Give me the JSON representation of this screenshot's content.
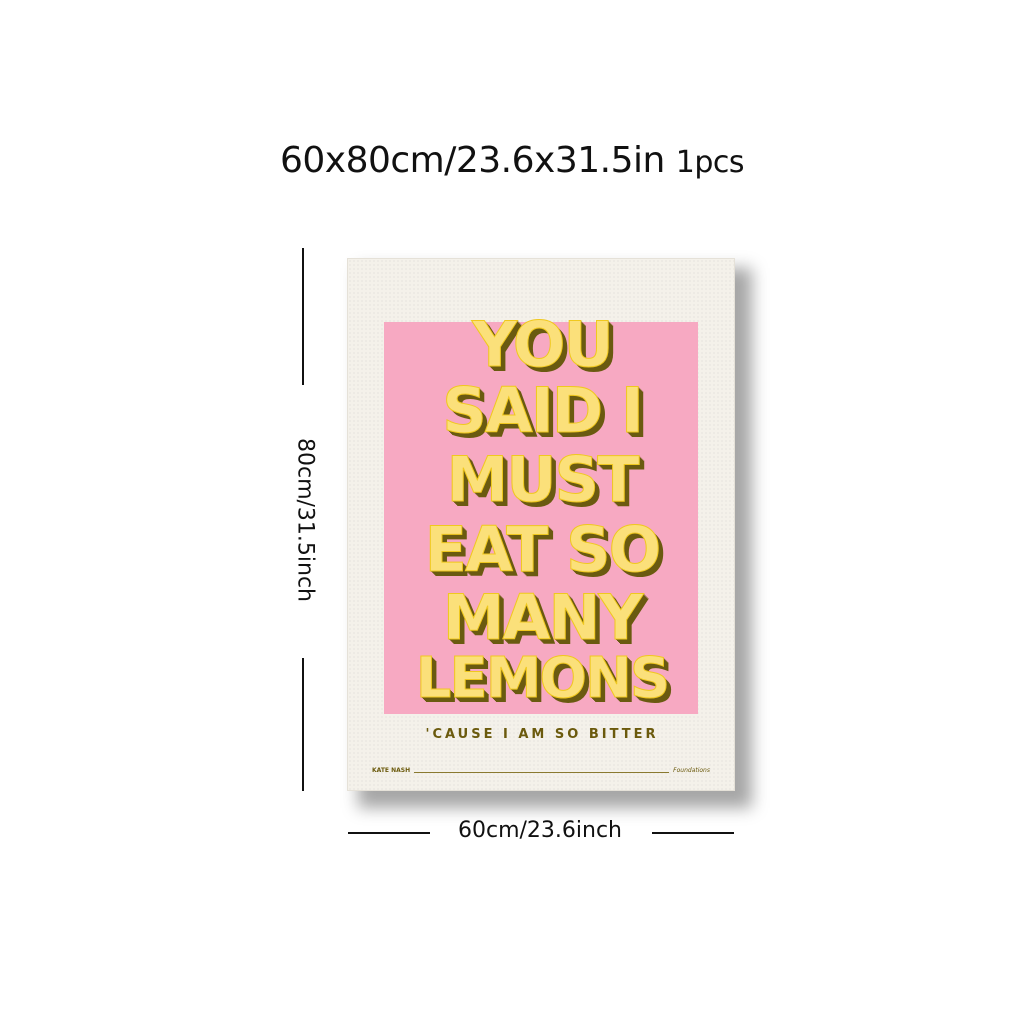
{
  "listing": {
    "size_title": "60x80cm/23.6x31.5in",
    "quantity": "1pcs",
    "height_label": "80cm/31.5inch",
    "width_label": "60cm/23.6inch"
  },
  "poster": {
    "lyric_lines": [
      "YOU",
      "SAID I",
      "MUST",
      "EAT SO",
      "MANY",
      "LEMONS"
    ],
    "subline": "'CAUSE I AM SO BITTER",
    "artist": "KATE NASH",
    "song": "Foundations",
    "colors": {
      "background": "#f4f1ea",
      "block": "#f7a9c2",
      "text": "#fbe07a",
      "shadow": "#6a5a10"
    }
  }
}
